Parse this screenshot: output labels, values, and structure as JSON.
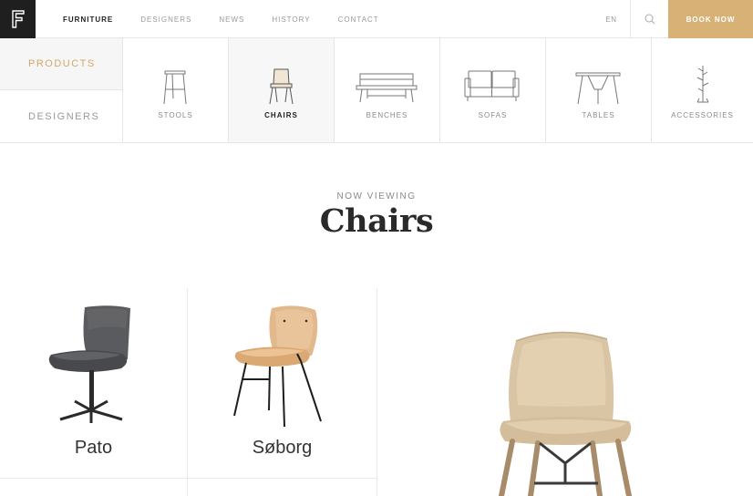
{
  "topbar": {
    "logo_letter": "F",
    "nav": [
      {
        "label": "FURNITURE",
        "active": true
      },
      {
        "label": "DESIGNERS",
        "active": false
      },
      {
        "label": "NEWS",
        "active": false
      },
      {
        "label": "HISTORY",
        "active": false
      },
      {
        "label": "CONTACT",
        "active": false
      }
    ],
    "language": "EN",
    "book_now": "BOOK NOW",
    "accent_color": "#d8b177"
  },
  "side_tabs": [
    {
      "label": "PRODUCTS",
      "active": true
    },
    {
      "label": "DESIGNERS",
      "active": false
    }
  ],
  "categories": [
    {
      "label": "STOOLS",
      "icon": "stool-icon",
      "active": false
    },
    {
      "label": "CHAIRS",
      "icon": "chair-icon",
      "active": true
    },
    {
      "label": "BENCHES",
      "icon": "bench-icon",
      "active": false
    },
    {
      "label": "SOFAS",
      "icon": "sofa-icon",
      "active": false
    },
    {
      "label": "TABLES",
      "icon": "table-icon",
      "active": false
    },
    {
      "label": "ACCESSORIES",
      "icon": "coat-rack-icon",
      "active": false
    }
  ],
  "heading": {
    "eyebrow": "NOW VIEWING",
    "title": "Chairs"
  },
  "products": [
    {
      "name": "Pato",
      "image": "grey-swivel-chair"
    },
    {
      "name": "Søborg",
      "image": "oak-plywood-chair"
    },
    {
      "name": "",
      "image": "upholstered-beige-chair"
    }
  ]
}
